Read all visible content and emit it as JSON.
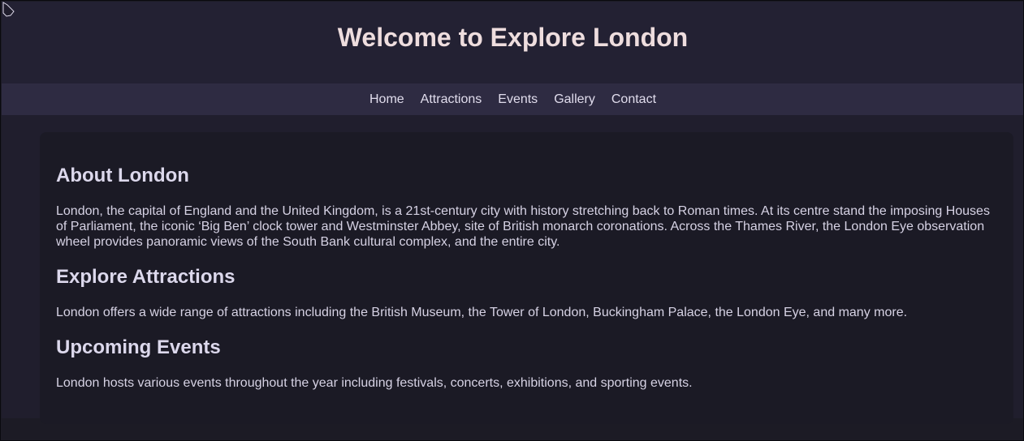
{
  "header": {
    "title": "Welcome to Explore London"
  },
  "nav": {
    "items": [
      "Home",
      "Attractions",
      "Events",
      "Gallery",
      "Contact"
    ]
  },
  "sections": [
    {
      "heading": "About London",
      "text": "London, the capital of England and the United Kingdom, is a 21st-century city with history stretching back to Roman times. At its centre stand the imposing Houses of Parliament, the iconic ‘Big Ben’ clock tower and Westminster Abbey, site of British monarch coronations. Across the Thames River, the London Eye observation wheel provides panoramic views of the South Bank cultural complex, and the entire city."
    },
    {
      "heading": "Explore Attractions",
      "text": "London offers a wide range of attractions including the British Museum, the Tower of London, Buckingham Palace, the London Eye, and many more."
    },
    {
      "heading": "Upcoming Events",
      "text": "London hosts various events throughout the year including festivals, concerts, exhibitions, and sporting events."
    }
  ]
}
